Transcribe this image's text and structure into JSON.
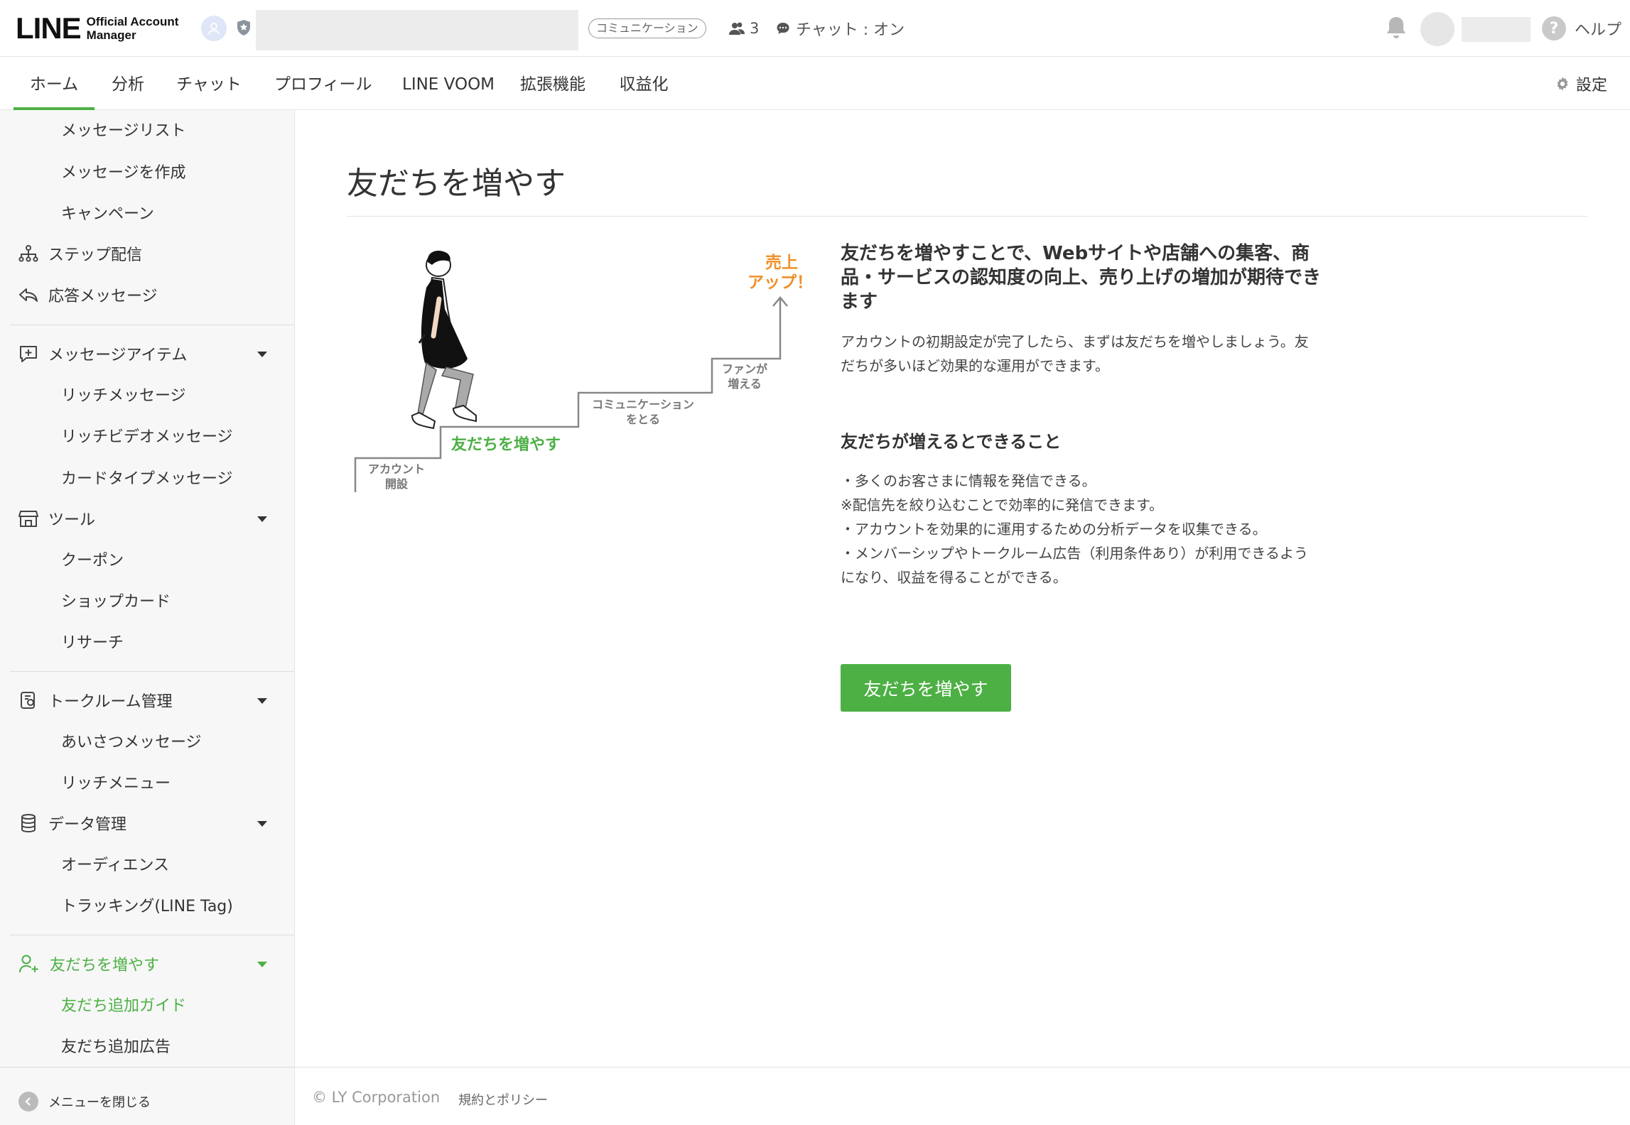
{
  "header": {
    "logo_main": "LINE",
    "logo_sub_line1": "Official Account",
    "logo_sub_line2": "Manager",
    "account_type_badge": "コミュニケーション",
    "friend_count": "3",
    "chat_status": "チャット : オン",
    "help_label": "ヘルプ",
    "icons": [
      "account-avatar-icon",
      "verified-shield-icon",
      "friends-icon",
      "chat-bubble-icon",
      "bell-icon",
      "help-icon"
    ]
  },
  "nav": {
    "tabs": [
      {
        "label": "ホーム",
        "active": true
      },
      {
        "label": "分析"
      },
      {
        "label": "チャット"
      },
      {
        "label": "プロフィール"
      },
      {
        "label": "LINE VOOM"
      },
      {
        "label": "拡張機能"
      },
      {
        "label": "収益化"
      }
    ],
    "settings_label": "設定"
  },
  "sidebar": {
    "items": [
      {
        "label": "メッセージリスト"
      },
      {
        "label": "メッセージを作成"
      },
      {
        "label": "キャンペーン"
      },
      {
        "label": "ステップ配信"
      },
      {
        "label": "応答メッセージ"
      },
      {
        "label": "メッセージアイテム"
      },
      {
        "label": "リッチメッセージ"
      },
      {
        "label": "リッチビデオメッセージ"
      },
      {
        "label": "カードタイプメッセージ"
      },
      {
        "label": "ツール"
      },
      {
        "label": "クーポン"
      },
      {
        "label": "ショップカード"
      },
      {
        "label": "リサーチ"
      },
      {
        "label": "トークルーム管理"
      },
      {
        "label": "あいさつメッセージ"
      },
      {
        "label": "リッチメニュー"
      },
      {
        "label": "データ管理"
      },
      {
        "label": "オーディエンス"
      },
      {
        "label": "トラッキング(LINE Tag)"
      },
      {
        "label": "友だちを増やす"
      },
      {
        "label": "友だち追加ガイド"
      },
      {
        "label": "友だち追加広告"
      }
    ],
    "close_menu_label": "メニューを閉じる"
  },
  "main": {
    "title": "友だちを増やす",
    "illustration": {
      "step1_line1": "アカウント",
      "step1_line2": "開設",
      "step2": "友だちを増やす",
      "step3_line1": "コミュニケーション",
      "step3_line2": "をとる",
      "step4_line1": "ファンが",
      "step4_line2": "増える",
      "goal_line1": "売上",
      "goal_line2": "アップ！"
    },
    "heading": "友だちを増やすことで、Webサイトや店舗への集客、商品・サービスの認知度の向上、売り上げの増加が期待できます",
    "description": "アカウントの初期設定が完了したら、まずは友だちを増やしましょう。友だちが多いほど効果的な運用ができます。",
    "benefits_heading": "友だちが増えるとできること",
    "benefits": [
      "・多くのお客さまに情報を発信できる。",
      "※配信先を絞り込むことで効率的に発信できます。",
      "・アカウントを効果的に運用するための分析データを収集できる。",
      "・メンバーシップやトークルーム広告（利用条件あり）が利用できるようになり、収益を得ることができる。"
    ],
    "cta_label": "友だちを増やす"
  },
  "footer": {
    "copyright": "© LY Corporation",
    "policy_link": "規約とポリシー"
  },
  "colors": {
    "accent_green": "#4cb044",
    "goal_orange": "#f0902a"
  }
}
